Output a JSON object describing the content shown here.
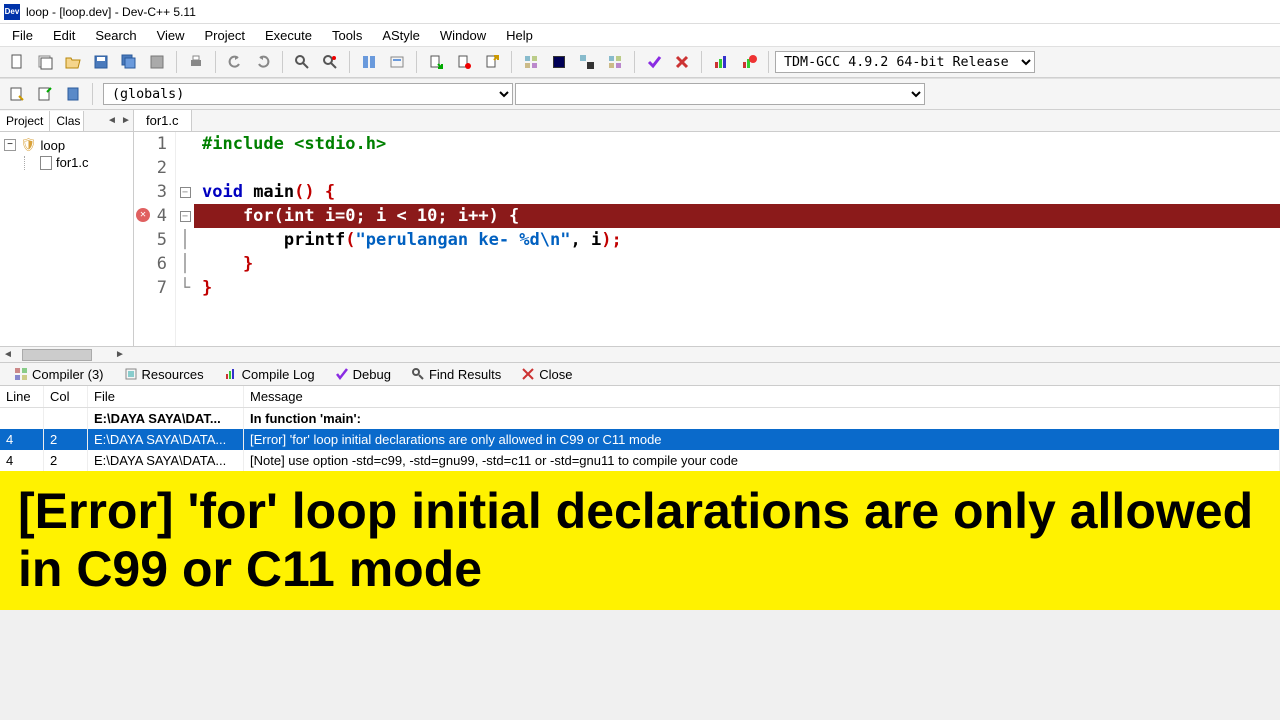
{
  "title": "loop - [loop.dev] - Dev-C++ 5.11",
  "menu": [
    "File",
    "Edit",
    "Search",
    "View",
    "Project",
    "Execute",
    "Tools",
    "AStyle",
    "Window",
    "Help"
  ],
  "compiler_combo": "TDM-GCC 4.9.2 64-bit Release",
  "scope_combo": "(globals)",
  "left_tabs": {
    "t1": "Project",
    "t2": "Clas"
  },
  "tree": {
    "root": "loop",
    "file": "for1.c"
  },
  "editor_tab": "for1.c",
  "code": {
    "l1_a": "#include ",
    "l1_b": "<stdio.h>",
    "l3_a": "void",
    "l3_b": " main",
    "l3_c": "() {",
    "l4": "    for(int i=0; i < 10; i++) {",
    "l5_a": "        printf",
    "l5_b": "(",
    "l5_c": "\"perulangan ke- %d\\n\"",
    "l5_d": ", i",
    "l5_e": ");",
    "l6": "    }",
    "l7": "}"
  },
  "line_nums": [
    "1",
    "2",
    "3",
    "4",
    "5",
    "6",
    "7"
  ],
  "bottom_tabs": {
    "compiler": "Compiler (3)",
    "resources": "Resources",
    "log": "Compile Log",
    "debug": "Debug",
    "find": "Find Results",
    "close": "Close"
  },
  "compiler_cols": {
    "line": "Line",
    "col": "Col",
    "file": "File",
    "msg": "Message"
  },
  "compiler_rows": [
    {
      "line": "",
      "col": "",
      "file": "E:\\DAYA SAYA\\DAT...",
      "msg": "In function 'main':",
      "cls": "header-msg"
    },
    {
      "line": "4",
      "col": "2",
      "file": "E:\\DAYA SAYA\\DATA...",
      "msg": "[Error] 'for' loop initial declarations are only allowed in C99 or C11 mode",
      "cls": "selected"
    },
    {
      "line": "4",
      "col": "2",
      "file": "E:\\DAYA SAYA\\DATA...",
      "msg": "[Note] use option -std=c99, -std=gnu99, -std=c11 or -std=gnu11 to compile your code",
      "cls": ""
    }
  ],
  "banner": "[Error] 'for' loop initial declarations are only allowed in C99 or C11 mode"
}
